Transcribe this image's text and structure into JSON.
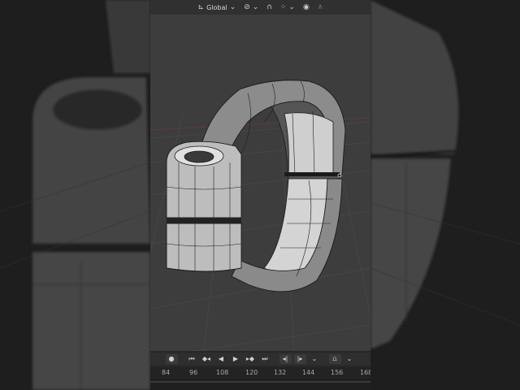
{
  "header": {
    "transform_orientation": "Global"
  },
  "icons": {
    "orientation": "axes-icon",
    "orientation_dropdown": "chevron-down-icon",
    "pivot": "link-icon",
    "snap": "magnet-icon",
    "snap_target": "grid-dots-icon",
    "proportional": "circle-dot-icon",
    "falloff": "falloff-curve-icon"
  },
  "timeline": {
    "controls": {
      "jump_start": "⏮",
      "prev_key": "◆◂",
      "play_reverse": "◀",
      "play": "▶",
      "next_key": "▸◆",
      "jump_end": "⏭",
      "prev_marker": "◂|",
      "next_marker": "|▸",
      "keying": "⌄"
    },
    "ticks": [
      "84",
      "96",
      "108",
      "120",
      "132",
      "144",
      "156",
      "168"
    ]
  },
  "colors": {
    "viewport_bg": "#3d3d3d",
    "header_bg": "#303030",
    "accent": "#4a6a9a"
  }
}
